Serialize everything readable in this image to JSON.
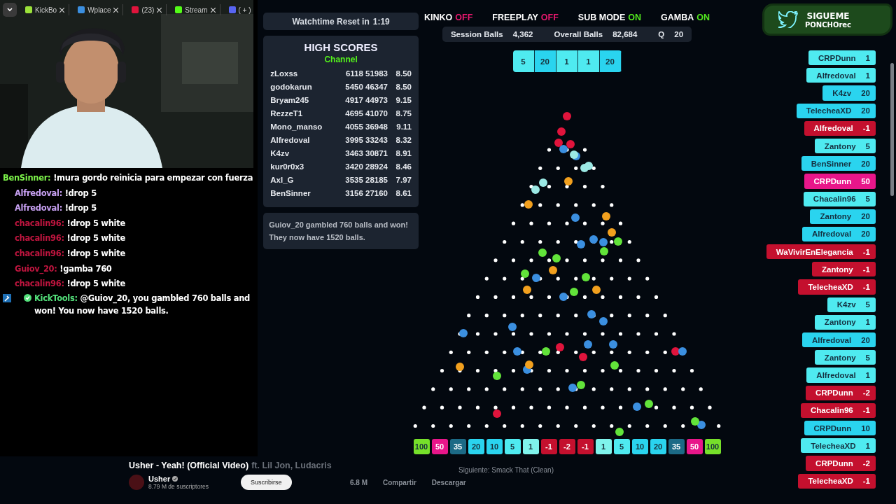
{
  "browser_tabs": [
    {
      "title": "KickBo"
    },
    {
      "title": "Wplace"
    },
    {
      "title": "(23)"
    },
    {
      "title": "Stream"
    },
    {
      "title": "( + )"
    }
  ],
  "chat": [
    {
      "user": "BenSinner:",
      "text": "!mura gordo reinicia para empezar con fuerza",
      "color": "#7cf24a",
      "kind": "user"
    },
    {
      "user": "Alfredoval:",
      "text": "!drop 5",
      "color": "#c7a0f2",
      "kind": "user"
    },
    {
      "user": "Alfredoval:",
      "text": "!drop 5",
      "color": "#c7a0f2",
      "kind": "user"
    },
    {
      "user": "chacalin96:",
      "text": "!drop 5 white",
      "color": "#c0153f",
      "kind": "user"
    },
    {
      "user": "chacalin96:",
      "text": "!drop 5 white",
      "color": "#c0153f",
      "kind": "user"
    },
    {
      "user": "chacalin96:",
      "text": "!drop 5 white",
      "color": "#c0153f",
      "kind": "user"
    },
    {
      "user": "Guiov_20:",
      "text": "!gamba 760",
      "color": "#c0153f",
      "kind": "user"
    },
    {
      "user": "chacalin96:",
      "text": "!drop 5 white",
      "color": "#c0153f",
      "kind": "user"
    },
    {
      "user": "KickTools:",
      "text": "@Guiov_20, you gambled 760 balls and won! You now have 1520 balls.",
      "color": "#53e07a",
      "kind": "bot"
    }
  ],
  "watchtime": {
    "label": "Watchtime Reset in",
    "value": "1:19"
  },
  "high_scores": {
    "title": "HIGH SCORES",
    "subtitle": "Channel",
    "rows": [
      {
        "cells": [
          "zLoxss",
          "6118 51983",
          "8.50"
        ]
      },
      {
        "cells": [
          "godokarun",
          "5450 46347",
          "8.50"
        ]
      },
      {
        "cells": [
          "Bryam245",
          "4917 44973",
          "9.15"
        ]
      },
      {
        "cells": [
          "RezzeT1",
          "4695 41070",
          "8.75"
        ]
      },
      {
        "cells": [
          "Mono_manso",
          "4055 36948",
          "9.11"
        ]
      },
      {
        "cells": [
          "Alfredoval",
          "3995 33243",
          "8.32"
        ]
      },
      {
        "cells": [
          "K4zv",
          "3463 30871",
          "8.91"
        ]
      },
      {
        "cells": [
          "kur0r0x3",
          "3420 28924",
          "8.46"
        ]
      },
      {
        "cells": [
          "Axl_G",
          "3535 28185",
          "7.97"
        ]
      },
      {
        "cells": [
          "BenSinner",
          "3156 27160",
          "8.61"
        ]
      }
    ]
  },
  "gamba_message": "Guiov_20 gambled 760 balls and won! They now have 1520 balls.",
  "toggles": [
    {
      "label": "KINKO",
      "state": "OFF",
      "on": false
    },
    {
      "label": "FREEPLAY",
      "state": "OFF",
      "on": false
    },
    {
      "label": "SUB MODE",
      "state": "ON",
      "on": true
    },
    {
      "label": "GAMBA",
      "state": "ON",
      "on": true
    }
  ],
  "stats": [
    {
      "label": "Session Balls",
      "value": "4,362"
    },
    {
      "label": "Overall Balls",
      "value": "82,684"
    },
    {
      "label": "Q",
      "value": "20"
    }
  ],
  "recent_drops": [
    {
      "value": "5",
      "color": "#4feaf0"
    },
    {
      "value": "20",
      "color": "#2ad4ef"
    },
    {
      "value": "1",
      "color": "#4feaf0"
    },
    {
      "value": "1",
      "color": "#4feaf0"
    },
    {
      "value": "20",
      "color": "#2ad4ef"
    }
  ],
  "slots": [
    {
      "value": "100",
      "color": "#76e02a"
    },
    {
      "value": "50",
      "color": "#e8168a"
    },
    {
      "value": "35",
      "color": "#1c6a86"
    },
    {
      "value": "20",
      "color": "#2ad4ef"
    },
    {
      "value": "10",
      "color": "#2ad4ef"
    },
    {
      "value": "5",
      "color": "#4feaf0"
    },
    {
      "value": "1",
      "color": "#7ff3ec"
    },
    {
      "value": "-1",
      "color": "#c4102e"
    },
    {
      "value": "-2",
      "color": "#c4102e"
    },
    {
      "value": "-1",
      "color": "#c4102e"
    },
    {
      "value": "1",
      "color": "#7ff3ec"
    },
    {
      "value": "5",
      "color": "#4feaf0"
    },
    {
      "value": "10",
      "color": "#2ad4ef"
    },
    {
      "value": "20",
      "color": "#2ad4ef"
    },
    {
      "value": "35",
      "color": "#1c6a86"
    },
    {
      "value": "50",
      "color": "#e8168a"
    },
    {
      "value": "100",
      "color": "#76e02a"
    }
  ],
  "social_banner": {
    "title": "SIGUEME",
    "handle": "PONCHOrec"
  },
  "drop_feed": [
    {
      "name": "CRPDunn",
      "value": "1",
      "color": "#4feaf0"
    },
    {
      "name": "Alfredoval",
      "value": "1",
      "color": "#4feaf0"
    },
    {
      "name": "K4zv",
      "value": "20",
      "color": "#2ad4ef"
    },
    {
      "name": "TelecheaXD",
      "value": "20",
      "color": "#2ad4ef"
    },
    {
      "name": "Alfredoval",
      "value": "-1",
      "color": "#c4102e"
    },
    {
      "name": "Zantony",
      "value": "5",
      "color": "#4feaf0"
    },
    {
      "name": "BenSinner",
      "value": "20",
      "color": "#2ad4ef"
    },
    {
      "name": "CRPDunn",
      "value": "50",
      "color": "#e8168a"
    },
    {
      "name": "Chacalin96",
      "value": "5",
      "color": "#4feaf0"
    },
    {
      "name": "Zantony",
      "value": "20",
      "color": "#2ad4ef"
    },
    {
      "name": "Alfredoval",
      "value": "20",
      "color": "#2ad4ef"
    },
    {
      "name": "WaVivirEnElegancia",
      "value": "-1",
      "color": "#c4102e"
    },
    {
      "name": "Zantony",
      "value": "-1",
      "color": "#c4102e"
    },
    {
      "name": "TelecheaXD",
      "value": "-1",
      "color": "#c4102e"
    },
    {
      "name": "K4zv",
      "value": "5",
      "color": "#4feaf0"
    },
    {
      "name": "Zantony",
      "value": "1",
      "color": "#4feaf0"
    },
    {
      "name": "Alfredoval",
      "value": "20",
      "color": "#2ad4ef"
    },
    {
      "name": "Zantony",
      "value": "5",
      "color": "#4feaf0"
    },
    {
      "name": "Alfredoval",
      "value": "1",
      "color": "#4feaf0"
    },
    {
      "name": "CRPDunn",
      "value": "-2",
      "color": "#c4102e"
    },
    {
      "name": "Chacalin96",
      "value": "-1",
      "color": "#c4102e"
    },
    {
      "name": "CRPDunn",
      "value": "10",
      "color": "#2ad4ef"
    },
    {
      "name": "TelecheaXD",
      "value": "1",
      "color": "#4feaf0"
    },
    {
      "name": "CRPDunn",
      "value": "-2",
      "color": "#c4102e"
    },
    {
      "name": "TelecheaXD",
      "value": "-1",
      "color": "#c4102e"
    }
  ],
  "video": {
    "title": "Usher - Yeah! (Official Video)",
    "featuring": "ft. Lil Jon, Ludacris",
    "channel": "Usher",
    "subscribers": "8.79 M de suscriptores",
    "subscribe": "Suscribirse",
    "likes": "6.8 M",
    "share": "Compartir",
    "download": "Descargar",
    "next": "Siguiente: Smack That (Clean)"
  }
}
